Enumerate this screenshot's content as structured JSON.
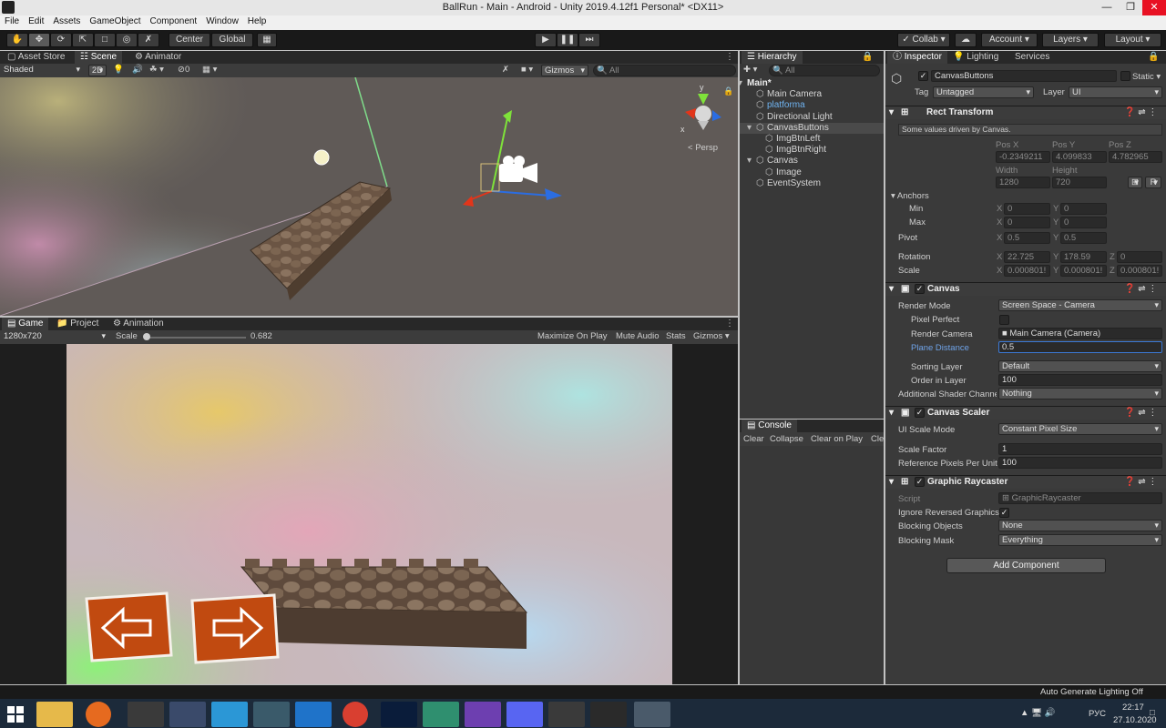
{
  "window": {
    "title": "BallRun - Main - Android - Unity 2019.4.12f1 Personal* <DX11>"
  },
  "menu": [
    "File",
    "Edit",
    "Assets",
    "GameObject",
    "Component",
    "Window",
    "Help"
  ],
  "toolbar": {
    "center": "Center",
    "global": "Global",
    "collab": "Collab",
    "account": "Account",
    "layers": "Layers",
    "layout": "Layout"
  },
  "scene": {
    "tabs": [
      "Asset Store",
      "Scene",
      "Animator"
    ],
    "shading": "Shaded",
    "mode2d": "2D",
    "hidden_count": "0",
    "gizmos": "Gizmos",
    "search_placeholder": "All",
    "persp": "Persp",
    "axis_x": "x",
    "axis_y": "y"
  },
  "game": {
    "tabs": [
      "Game",
      "Project",
      "Animation"
    ],
    "resolution": "1280x720",
    "scale_label": "Scale",
    "scale_value": "0.682",
    "scale_fraction": 0.03,
    "maximize": "Maximize On Play",
    "mute": "Mute Audio",
    "stats": "Stats",
    "gizmos": "Gizmos"
  },
  "hierarchy": {
    "tab": "Hierarchy",
    "search_placeholder": "All",
    "items": [
      {
        "label": "Main*",
        "depth": 0,
        "expanded": true,
        "scene": true
      },
      {
        "label": "Main Camera",
        "depth": 1
      },
      {
        "label": "platforma",
        "depth": 1,
        "highlight": true
      },
      {
        "label": "Directional Light",
        "depth": 1
      },
      {
        "label": "CanvasButtons",
        "depth": 1,
        "expanded": true,
        "selected": true
      },
      {
        "label": "ImgBtnLeft",
        "depth": 2
      },
      {
        "label": "ImgBtnRight",
        "depth": 2
      },
      {
        "label": "Canvas",
        "depth": 1,
        "expanded": true
      },
      {
        "label": "Image",
        "depth": 2
      },
      {
        "label": "EventSystem",
        "depth": 1
      }
    ]
  },
  "console": {
    "tab": "Console",
    "buttons": [
      "Clear",
      "Collapse",
      "Clear on Play",
      "Cle"
    ]
  },
  "inspector": {
    "tabs": [
      "Inspector",
      "Lighting",
      "Services"
    ],
    "object_name": "CanvasButtons",
    "static_label": "Static",
    "tag_label": "Tag",
    "tag_value": "Untagged",
    "layer_label": "Layer",
    "layer_value": "UI",
    "rect": {
      "title": "Rect Transform",
      "note": "Some values driven by Canvas.",
      "posx_label": "Pos X",
      "posy_label": "Pos Y",
      "posz_label": "Pos Z",
      "posx": "-0.2349211",
      "posy": "4.099833",
      "posz": "4.782965",
      "width_label": "Width",
      "height_label": "Height",
      "width": "1280",
      "height": "720",
      "r_btn": "R",
      "anchors_label": "Anchors",
      "min_label": "Min",
      "max_label": "Max",
      "min_x": "0",
      "min_y": "0",
      "max_x": "0",
      "max_y": "0",
      "pivot_label": "Pivot",
      "pivot_x": "0.5",
      "pivot_y": "0.5",
      "rotation_label": "Rotation",
      "rot_x": "22.725",
      "rot_y": "178.59",
      "rot_z": "0",
      "scale_label": "Scale",
      "scale_x": "0.000801!",
      "scale_y": "0.000801!",
      "scale_z": "0.000801!",
      "x": "X",
      "y": "Y",
      "z": "Z"
    },
    "canvas": {
      "title": "Canvas",
      "render_mode_label": "Render Mode",
      "render_mode": "Screen Space - Camera",
      "pixel_perfect_label": "Pixel Perfect",
      "render_camera_label": "Render Camera",
      "render_camera": "Main Camera (Camera)",
      "plane_distance_label": "Plane Distance",
      "plane_distance": "0.5",
      "sorting_layer_label": "Sorting Layer",
      "sorting_layer": "Default",
      "order_label": "Order in Layer",
      "order": "100",
      "shader_label": "Additional Shader Channe",
      "shader": "Nothing"
    },
    "scaler": {
      "title": "Canvas Scaler",
      "mode_label": "UI Scale Mode",
      "mode": "Constant Pixel Size",
      "factor_label": "Scale Factor",
      "factor": "1",
      "ppu_label": "Reference Pixels Per Unit",
      "ppu": "100"
    },
    "raycaster": {
      "title": "Graphic Raycaster",
      "script_label": "Script",
      "script": "GraphicRaycaster",
      "ignore_label": "Ignore Reversed Graphics",
      "blocking_objects_label": "Blocking Objects",
      "blocking_objects": "None",
      "blocking_mask_label": "Blocking Mask",
      "blocking_mask": "Everything"
    },
    "add_component": "Add Component"
  },
  "statusbar": {
    "text": "Auto Generate Lighting Off"
  },
  "taskbar": {
    "lang": "РУС",
    "time": "22:17",
    "date": "27.10.2020"
  }
}
